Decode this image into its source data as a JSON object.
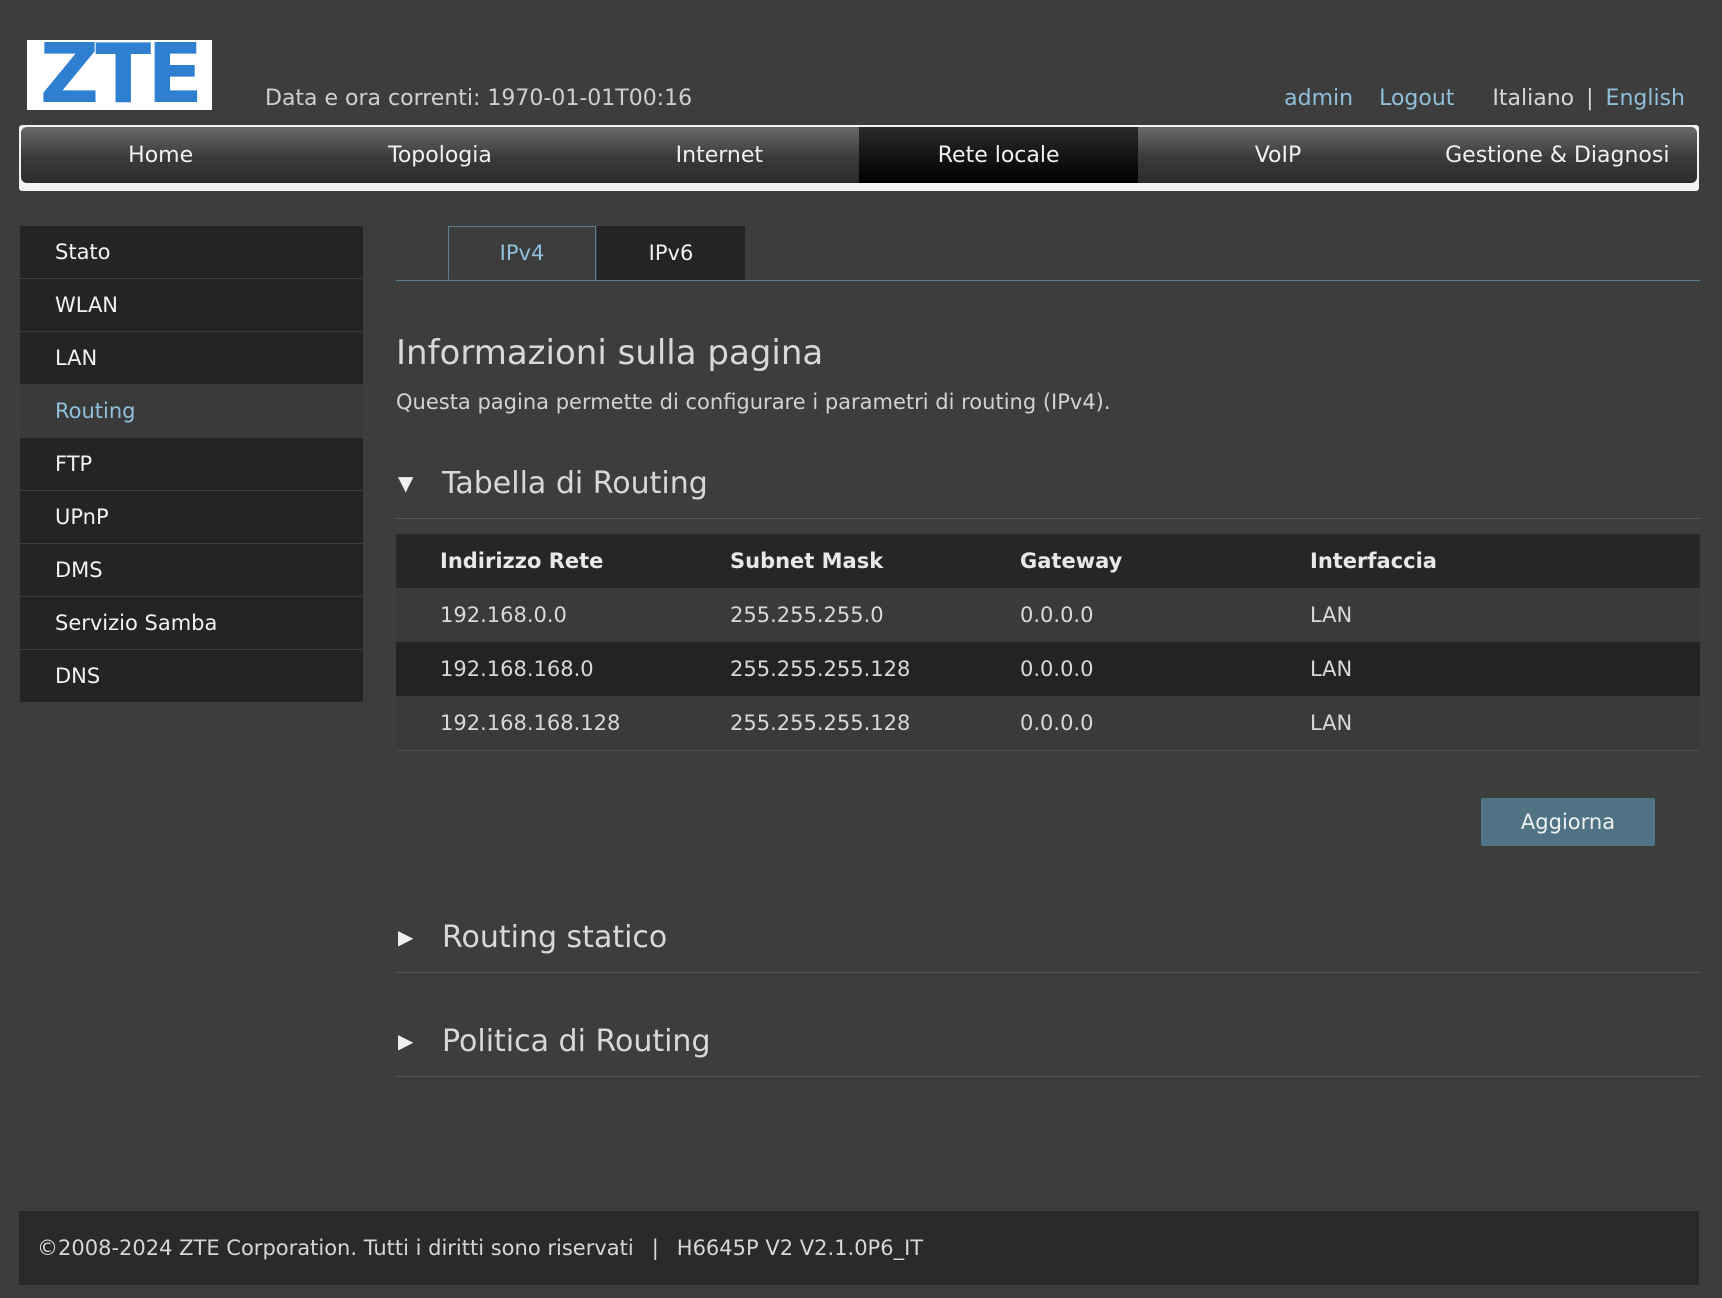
{
  "header": {
    "logo": "ZTE",
    "datetime": "Data e ora correnti: 1970-01-01T00:16",
    "user": "admin",
    "logout": "Logout",
    "lang_current": "Italiano",
    "lang_sep": "|",
    "lang_other": "English"
  },
  "nav": {
    "items": [
      {
        "label": "Home"
      },
      {
        "label": "Topologia"
      },
      {
        "label": "Internet"
      },
      {
        "label": "Rete locale",
        "active": true
      },
      {
        "label": "VoIP"
      },
      {
        "label": "Gestione & Diagnosi"
      }
    ]
  },
  "sidebar": {
    "items": [
      {
        "label": "Stato"
      },
      {
        "label": "WLAN"
      },
      {
        "label": "LAN"
      },
      {
        "label": "Routing",
        "active": true
      },
      {
        "label": "FTP"
      },
      {
        "label": "UPnP"
      },
      {
        "label": "DMS"
      },
      {
        "label": "Servizio Samba"
      },
      {
        "label": "DNS"
      }
    ]
  },
  "tabs": [
    {
      "label": "IPv4",
      "active": true
    },
    {
      "label": "IPv6"
    }
  ],
  "page": {
    "title": "Informazioni sulla pagina",
    "description": "Questa pagina permette di configurare i parametri di routing (IPv4)."
  },
  "routing_table": {
    "title": "Tabella di Routing",
    "columns": [
      "Indirizzo Rete",
      "Subnet Mask",
      "Gateway",
      "Interfaccia"
    ],
    "rows": [
      [
        "192.168.0.0",
        "255.255.255.0",
        "0.0.0.0",
        "LAN"
      ],
      [
        "192.168.168.0",
        "255.255.255.128",
        "0.0.0.0",
        "LAN"
      ],
      [
        "192.168.168.128",
        "255.255.255.128",
        "0.0.0.0",
        "LAN"
      ]
    ],
    "refresh_button": "Aggiorna"
  },
  "sections": {
    "static_routing": "Routing statico",
    "routing_policy": "Politica di Routing"
  },
  "icons": {
    "expanded": "▼",
    "collapsed": "▶"
  },
  "footer": {
    "copyright": "©2008-2024 ZTE Corporation. Tutti i diritti sono riservati",
    "sep": "|",
    "version": "H6645P V2 V2.1.0P6_IT"
  },
  "colors": {
    "background": "#3d3d3d",
    "accent": "#8fc1dc",
    "button": "#4f7385",
    "logo_blue": "#2f7fd1"
  }
}
